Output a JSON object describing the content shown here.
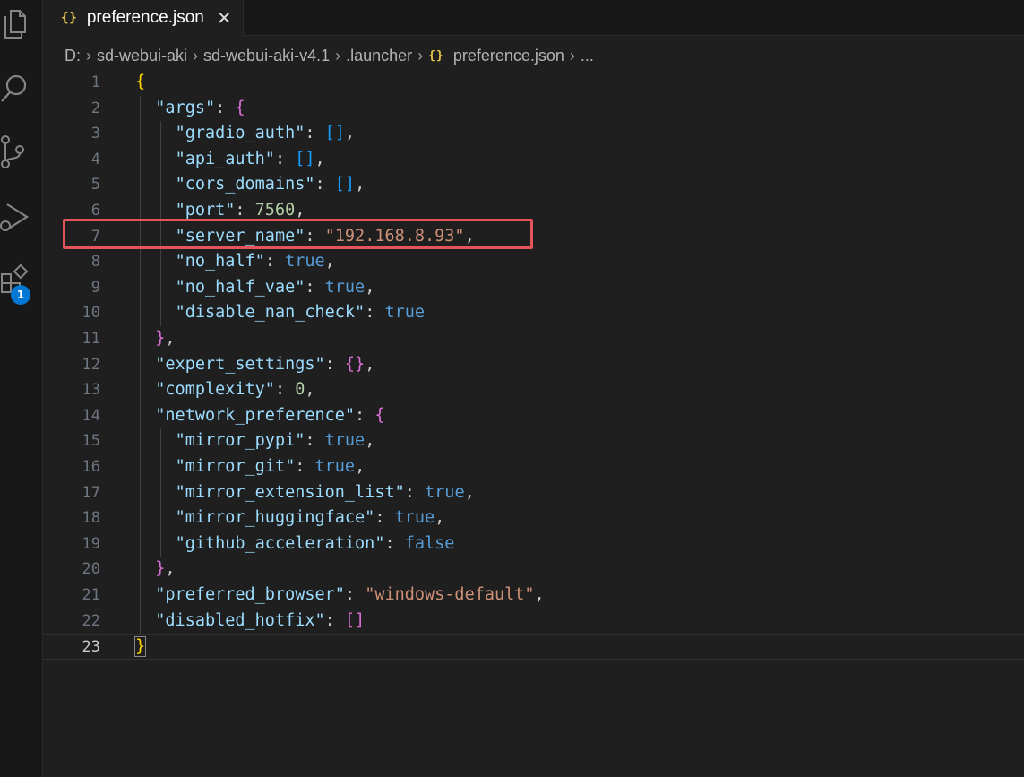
{
  "tab": {
    "icon": "json-braces-icon",
    "label": "preference.json",
    "close": "✕"
  },
  "breadcrumb": {
    "drive": "D:",
    "folder1": "sd-webui-aki",
    "folder2": "sd-webui-aki-v4.1",
    "folder3": ".launcher",
    "file": "preference.json",
    "more": "..."
  },
  "activity_bar": {
    "icons": [
      "explorer-icon",
      "search-icon",
      "source-control-icon",
      "run-debug-icon",
      "extensions-icon"
    ],
    "extensions_badge": "1"
  },
  "editor": {
    "active_line": 23,
    "highlighted_line": 7,
    "line_numbers": [
      "1",
      "2",
      "3",
      "4",
      "5",
      "6",
      "7",
      "8",
      "9",
      "10",
      "11",
      "12",
      "13",
      "14",
      "15",
      "16",
      "17",
      "18",
      "19",
      "20",
      "21",
      "22",
      "23"
    ],
    "tokens": {
      "l1": "{",
      "l2": [
        "\"args\"",
        ": ",
        "{"
      ],
      "l3": [
        "\"gradio_auth\"",
        ": ",
        "[]",
        ","
      ],
      "l4": [
        "\"api_auth\"",
        ": ",
        "[]",
        ","
      ],
      "l5": [
        "\"cors_domains\"",
        ": ",
        "[]",
        ","
      ],
      "l6": [
        "\"port\"",
        ": ",
        "7560",
        ","
      ],
      "l7": [
        "\"server_name\"",
        ": ",
        "\"192.168.8.93\"",
        ","
      ],
      "l8": [
        "\"no_half\"",
        ": ",
        "true",
        ","
      ],
      "l9": [
        "\"no_half_vae\"",
        ": ",
        "true",
        ","
      ],
      "l10": [
        "\"disable_nan_check\"",
        ": ",
        "true"
      ],
      "l11": [
        "}",
        ","
      ],
      "l12": [
        "\"expert_settings\"",
        ": ",
        "{}",
        ","
      ],
      "l13": [
        "\"complexity\"",
        ": ",
        "0",
        ","
      ],
      "l14": [
        "\"network_preference\"",
        ": ",
        "{"
      ],
      "l15": [
        "\"mirror_pypi\"",
        ": ",
        "true",
        ","
      ],
      "l16": [
        "\"mirror_git\"",
        ": ",
        "true",
        ","
      ],
      "l17": [
        "\"mirror_extension_list\"",
        ": ",
        "true",
        ","
      ],
      "l18": [
        "\"mirror_huggingface\"",
        ": ",
        "true",
        ","
      ],
      "l19": [
        "\"github_acceleration\"",
        ": ",
        "false"
      ],
      "l20": [
        "}",
        ","
      ],
      "l21": [
        "\"preferred_browser\"",
        ": ",
        "\"windows-default\"",
        ","
      ],
      "l22": [
        "\"disabled_hotfix\"",
        ": ",
        "[]"
      ],
      "l23": "}"
    }
  },
  "colors": {
    "key": "#9cdcfe",
    "string": "#ce9178",
    "number": "#b5cea8",
    "boolean": "#569cd6",
    "bracket_level1": "#ffd700",
    "bracket_level2": "#da70d6",
    "bracket_level3": "#179fff",
    "highlight_box": "#e5545a",
    "badge": "#0078d4"
  }
}
